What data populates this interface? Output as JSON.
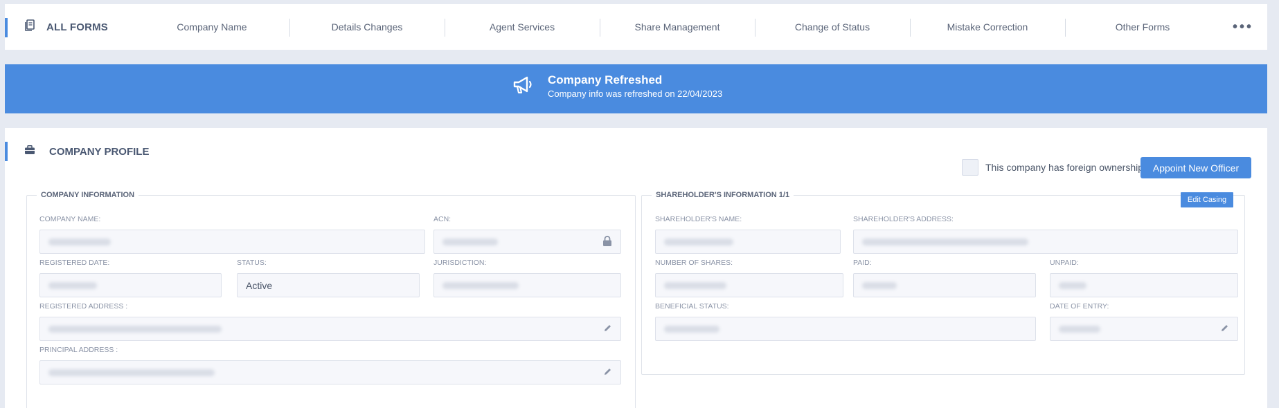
{
  "nav": {
    "all_forms": "ALL FORMS",
    "tabs": [
      "Company Name",
      "Details Changes",
      "Agent Services",
      "Share Management",
      "Change of Status",
      "Mistake Correction",
      "Other Forms"
    ],
    "more": "•••"
  },
  "banner": {
    "title": "Company Refreshed",
    "subtitle": "Company info was refreshed on 22/04/2023"
  },
  "profile": {
    "title": "COMPANY PROFILE",
    "foreign_label": "This company has foreign ownership",
    "appoint_label": "Appoint New Officer",
    "company": {
      "legend": "COMPANY INFORMATION",
      "name_label": "COMPANY NAME:",
      "acn_label": "ACN:",
      "registered_date_label": "REGISTERED DATE:",
      "status_label": "STATUS:",
      "status_value": "Active",
      "jurisdiction_label": "JURISDICTION:",
      "registered_address_label": "REGISTERED ADDRESS :",
      "principal_address_label": "PRINCIPAL ADDRESS :"
    },
    "shareholder": {
      "legend": "SHAREHOLDER'S INFORMATION 1/1",
      "edit_casing": "Edit Casing",
      "name_label": "SHAREHOLDER'S NAME:",
      "address_label": "SHAREHOLDER'S ADDRESS:",
      "shares_label": "NUMBER OF SHARES:",
      "paid_label": "PAID:",
      "unpaid_label": "UNPAID:",
      "beneficial_label": "BENEFICIAL STATUS:",
      "entry_label": "DATE OF ENTRY:"
    }
  },
  "colors": {
    "accent": "#4a8bdf",
    "background": "#e6eaf2"
  }
}
